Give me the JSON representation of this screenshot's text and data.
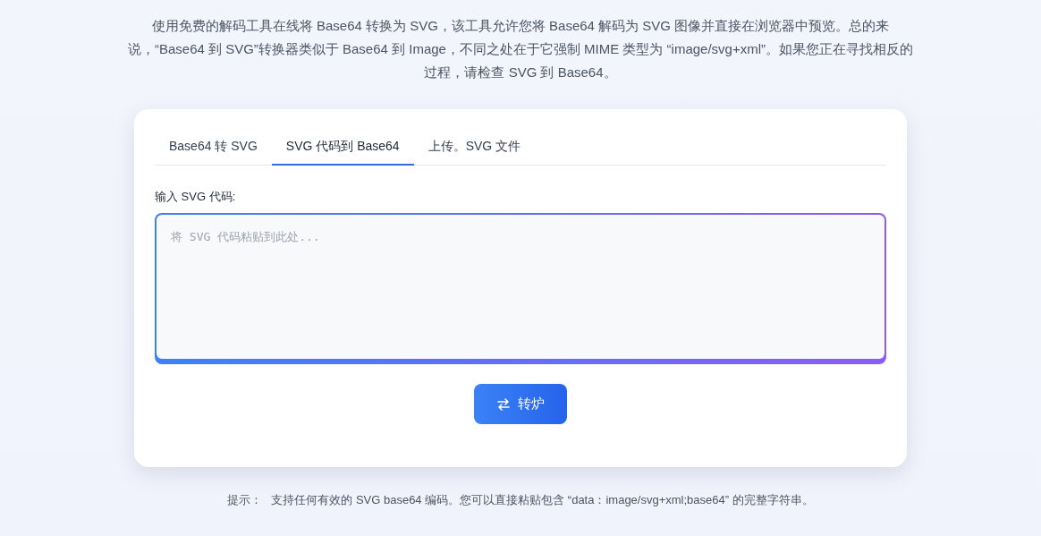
{
  "description": "使用免费的解码工具在线将 Base64 转换为 SVG，该工具允许您将 Base64 解码为 SVG 图像并直接在浏览器中预览。总的来说，“Base64 到 SVG”转换器类似于 Base64 到 Image，不同之处在于它强制 MIME 类型为 “image/svg+xml”。如果您正在寻找相反的过程，请检查 SVG 到 Base64。",
  "tabs": [
    {
      "label": "Base64 转 SVG",
      "selected": false
    },
    {
      "label": "SVG 代码到 Base64",
      "selected": true
    },
    {
      "label": "上传。SVG 文件",
      "selected": false
    }
  ],
  "input": {
    "label": "输入 SVG 代码:",
    "placeholder": "将 SVG 代码粘贴到此处..."
  },
  "convert_button": {
    "label": "转炉"
  },
  "hint": {
    "label": "提示：",
    "text": "支持任何有效的 SVG base64 编码。您可以直接粘贴包含 “data：image/svg+xml;base64” 的完整字符串。"
  }
}
